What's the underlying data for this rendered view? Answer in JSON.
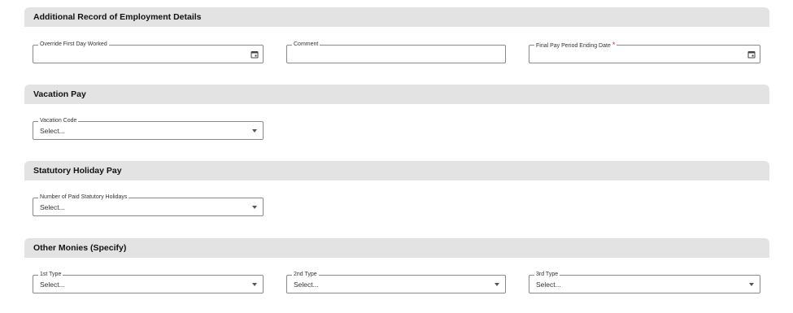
{
  "sections": {
    "employment": {
      "title": "Additional Record of Employment Details",
      "override_first_day": {
        "label": "Override First Day Worked",
        "value": ""
      },
      "comment": {
        "label": "Comment",
        "value": ""
      },
      "final_pay_period": {
        "label": "Final Pay Period Ending Date",
        "required_marker": "*",
        "value": ""
      }
    },
    "vacation": {
      "title": "Vacation Pay",
      "vacation_code": {
        "label": "Vacation Code",
        "value": "Select..."
      }
    },
    "statutory": {
      "title": "Statutory Holiday Pay",
      "paid_holidays": {
        "label": "Number of Paid Statutory Holidays",
        "value": "Select..."
      }
    },
    "other_monies": {
      "title": "Other Monies (Specify)",
      "first_type": {
        "label": "1st Type",
        "value": "Select..."
      },
      "second_type": {
        "label": "2nd Type",
        "value": "Select..."
      },
      "third_type": {
        "label": "3rd Type",
        "value": "Select..."
      }
    }
  },
  "colors": {
    "section_header_bg": "#e3e3e3",
    "field_border": "#8a8a8a",
    "required": "#d32f2f"
  },
  "icons": {
    "date_picker": "calendar-icon",
    "dropdown": "chevron-down-icon"
  }
}
